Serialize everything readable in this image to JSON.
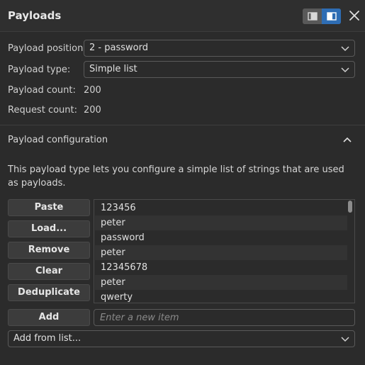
{
  "header": {
    "title": "Payloads",
    "layout_toggle": {
      "left_icon": "list-layout-icon",
      "right_icon": "split-layout-icon",
      "active": "right"
    },
    "close_icon": "close-icon"
  },
  "settings": {
    "position_label": "Payload position:",
    "position_value": "2 - password",
    "type_label": "Payload type:",
    "type_value": "Simple list",
    "count_label": "Payload count:",
    "count_value": "200",
    "request_label": "Request count:",
    "request_value": "200"
  },
  "config": {
    "title": "Payload configuration",
    "description": "This payload type lets you configure a simple list of strings that are used as payloads."
  },
  "buttons": {
    "paste": "Paste",
    "load": "Load...",
    "remove": "Remove",
    "clear": "Clear",
    "deduplicate": "Deduplicate",
    "add": "Add"
  },
  "list": {
    "items": [
      "123456",
      "peter",
      "password",
      "peter",
      "12345678",
      "peter",
      "qwerty"
    ]
  },
  "new_item": {
    "placeholder": "Enter a new item",
    "value": ""
  },
  "add_from_list": {
    "value": "Add from list..."
  },
  "colors": {
    "accent": "#2e6db4",
    "background": "#2b2b2b",
    "button": "#3c3c3c"
  }
}
